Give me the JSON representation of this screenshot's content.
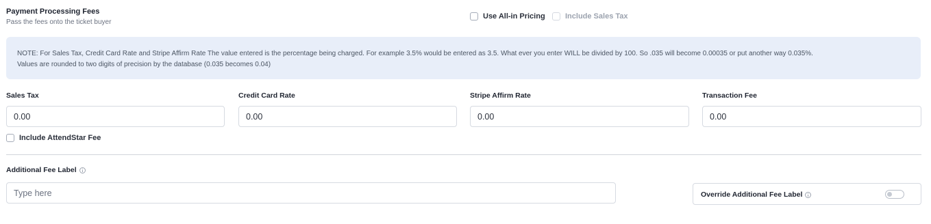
{
  "section": {
    "title": "Payment Processing Fees",
    "subtitle": "Pass the fees onto the ticket buyer"
  },
  "options": {
    "all_in_pricing": {
      "label": "Use All-in Pricing",
      "checked": false
    },
    "include_sales_tax": {
      "label": "Include Sales Tax",
      "checked": false,
      "disabled": true
    },
    "include_attendstar_fee": {
      "label": "Include AttendStar Fee",
      "checked": false
    }
  },
  "note": {
    "line1": "NOTE: For Sales Tax, Credit Card Rate and Stripe Affirm Rate The value entered is the percentage being charged. For example 3.5% would be entered as 3.5. What ever you enter WILL be divided by 100. So .035 will become 0.00035 or put another way 0.035%.",
    "line2": "Values are rounded to two digits of precision by the database (0.035 becomes 0.04)"
  },
  "fields": {
    "sales_tax": {
      "label": "Sales Tax",
      "value": "0.00"
    },
    "credit_card_rate": {
      "label": "Credit Card Rate",
      "value": "0.00"
    },
    "stripe_affirm_rate": {
      "label": "Stripe Affirm Rate",
      "value": "0.00"
    },
    "transaction_fee": {
      "label": "Transaction Fee",
      "value": "0.00"
    }
  },
  "additional_fee": {
    "label": "Additional Fee Label",
    "placeholder": "Type here",
    "value": ""
  },
  "override": {
    "label": "Override Additional Fee Label",
    "enabled": false
  },
  "icons": {
    "info": "info-circle-icon"
  },
  "colors": {
    "note_background": "#e8eef9",
    "border": "#d6dae1",
    "disabled_text": "#9ca3af"
  }
}
